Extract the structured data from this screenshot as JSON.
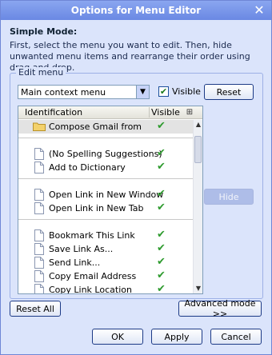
{
  "window": {
    "title": "Options for Menu Editor"
  },
  "mode": {
    "title": "Simple Mode:",
    "description": "First, select the menu you want to edit. Then, hide unwanted menu items and rearrange their order using drag and drop."
  },
  "edit_menu": {
    "group_label": "Edit menu",
    "selected_menu": "Main context menu",
    "visible_label": "Visible",
    "visible_checked": true,
    "reset_label": "Reset",
    "hide_label": "Hide"
  },
  "list": {
    "col_identification": "Identification",
    "col_visible": "Visible",
    "rows": [
      {
        "label": "Compose Gmail from",
        "icon": "folder-icon",
        "visible": true
      },
      {
        "label": "(No Spelling Suggestions)",
        "icon": "document-icon",
        "visible": true
      },
      {
        "label": "Add to Dictionary",
        "icon": "document-icon",
        "visible": true
      },
      {
        "label": "Open Link in New Window",
        "icon": "document-icon",
        "visible": true
      },
      {
        "label": "Open Link in New Tab",
        "icon": "document-icon",
        "visible": true
      },
      {
        "label": "Bookmark This Link",
        "icon": "document-icon",
        "visible": true
      },
      {
        "label": "Save Link As...",
        "icon": "document-icon",
        "visible": true
      },
      {
        "label": "Send Link...",
        "icon": "document-icon",
        "visible": true
      },
      {
        "label": "Copy Email Address",
        "icon": "document-icon",
        "visible": true
      },
      {
        "label": "Copy Link Location",
        "icon": "document-icon",
        "visible": true
      }
    ]
  },
  "buttons": {
    "reset_all": "Reset All",
    "advanced_mode": "Advanced mode >>",
    "ok": "OK",
    "apply": "Apply",
    "cancel": "Cancel"
  },
  "glyphs": {
    "check": "✔",
    "dropdown": "▼",
    "scroll_up": "▲",
    "scroll_down": "▼",
    "close": "✕",
    "column_picker": "⊞"
  },
  "colors": {
    "title_bar": "#6a88e3",
    "dialog_bg": "#dbe4fb",
    "check_green": "#2f9b2f"
  }
}
